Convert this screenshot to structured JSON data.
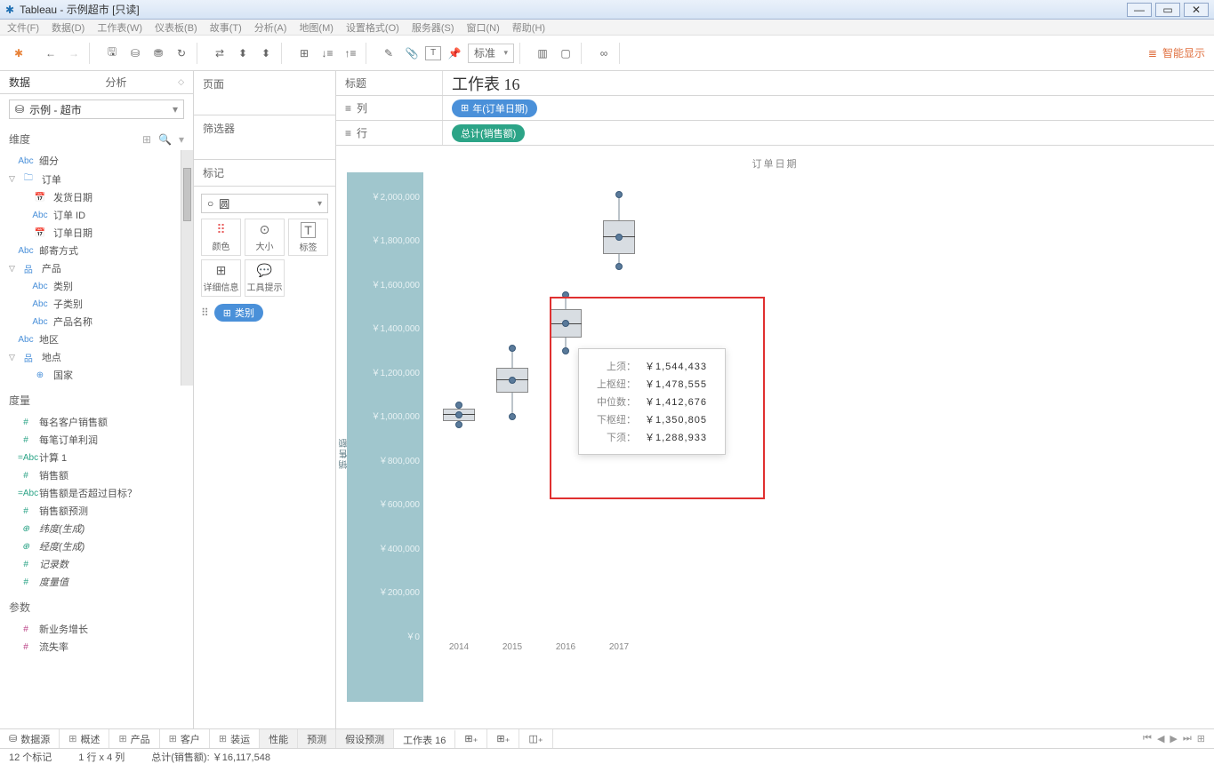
{
  "titlebar": {
    "app": "Tableau - 示例超市 [只读]"
  },
  "menu": [
    "文件(F)",
    "数据(D)",
    "工作表(W)",
    "仪表板(B)",
    "故事(T)",
    "分析(A)",
    "地图(M)",
    "设置格式(O)",
    "服务器(S)",
    "窗口(N)",
    "帮助(H)"
  ],
  "toolbar": {
    "fit": "标准",
    "smart": "智能显示"
  },
  "datapane": {
    "tab_data": "数据",
    "tab_analysis": "分析",
    "datasource": "示例 - 超市",
    "sec_dims": "维度",
    "dims": [
      {
        "i": "Abc",
        "t": "细分",
        "lvl": 1
      },
      {
        "i": "📁",
        "t": "订单",
        "lvl": 0,
        "exp": true
      },
      {
        "i": "📅",
        "t": "发货日期",
        "lvl": 2
      },
      {
        "i": "Abc",
        "t": "订单 ID",
        "lvl": 2
      },
      {
        "i": "📅",
        "t": "订单日期",
        "lvl": 2
      },
      {
        "i": "Abc",
        "t": "邮寄方式",
        "lvl": 1
      },
      {
        "i": "品",
        "t": "产品",
        "lvl": 0,
        "exp": true
      },
      {
        "i": "Abc",
        "t": "类别",
        "lvl": 2
      },
      {
        "i": "Abc",
        "t": "子类别",
        "lvl": 2
      },
      {
        "i": "Abc",
        "t": "产品名称",
        "lvl": 2
      },
      {
        "i": "Abc",
        "t": "地区",
        "lvl": 1
      },
      {
        "i": "品",
        "t": "地点",
        "lvl": 0,
        "exp": true
      },
      {
        "i": "⊕",
        "t": "国家",
        "lvl": 2
      }
    ],
    "sec_meas": "度量",
    "measures": [
      "每名客户销售额",
      "每笔订单利润",
      "计算 1",
      "销售额",
      "销售额是否超过目标？",
      "销售额预测"
    ],
    "measures_italic": [
      "纬度(生成)",
      "经度(生成)",
      "记录数",
      "度量值"
    ],
    "sec_params": "参数",
    "params": [
      "新业务增长",
      "流失率"
    ]
  },
  "shelves": {
    "pages": "页面",
    "filters": "筛选器",
    "marks": "标记",
    "shape": "圆",
    "shape_sym": "○",
    "cells": {
      "color": "颜色",
      "size": "大小",
      "label": "标签",
      "detail": "详细信息",
      "tooltip": "工具提示"
    },
    "mark_pill": "类别",
    "title_lbl": "标题",
    "sheet_title": "工作表 16",
    "cols": "列",
    "col_pill": "年(订单日期)",
    "rows": "行",
    "row_pill": "总计(销售额)"
  },
  "chart_data": {
    "type": "boxplot",
    "title": "订单日期",
    "ylabel": "销售额",
    "ylim": [
      0,
      2100000
    ],
    "yticks": [
      "￥0",
      "￥200,000",
      "￥400,000",
      "￥600,000",
      "￥800,000",
      "￥1,000,000",
      "￥1,200,000",
      "￥1,400,000",
      "￥1,600,000",
      "￥1,800,000",
      "￥2,000,000"
    ],
    "categories": [
      "2014",
      "2015",
      "2016",
      "2017"
    ],
    "series": [
      {
        "uw": 1040000,
        "q3": 1025000,
        "med": 1000000,
        "q1": 970000,
        "lw": 955000
      },
      {
        "uw": 1300000,
        "q3": 1210000,
        "med": 1160000,
        "q1": 1100000,
        "lw": 990000
      },
      {
        "uw": 1544433,
        "q3": 1478555,
        "med": 1412676,
        "q1": 1350805,
        "lw": 1288933
      },
      {
        "uw": 2000000,
        "q3": 1880000,
        "med": 1810000,
        "q1": 1730000,
        "lw": 1670000
      }
    ]
  },
  "tooltip": {
    "rows": [
      {
        "l": "上须：",
        "v": "￥1,544,433"
      },
      {
        "l": "上枢纽：",
        "v": "￥1,478,555"
      },
      {
        "l": "中位数：",
        "v": "￥1,412,676"
      },
      {
        "l": "下枢纽：",
        "v": "￥1,350,805"
      },
      {
        "l": "下须：",
        "v": "￥1,288,933"
      }
    ]
  },
  "tabs": {
    "datasource": "数据源",
    "sheets": [
      "概述",
      "产品",
      "客户",
      "装运"
    ],
    "grey": [
      "性能",
      "预测",
      "假设预测"
    ],
    "active": "工作表 16"
  },
  "status": {
    "marks": "12 个标记",
    "rc": "1 行 x 4 列",
    "sum": "总计(销售额): ￥16,117,548"
  }
}
